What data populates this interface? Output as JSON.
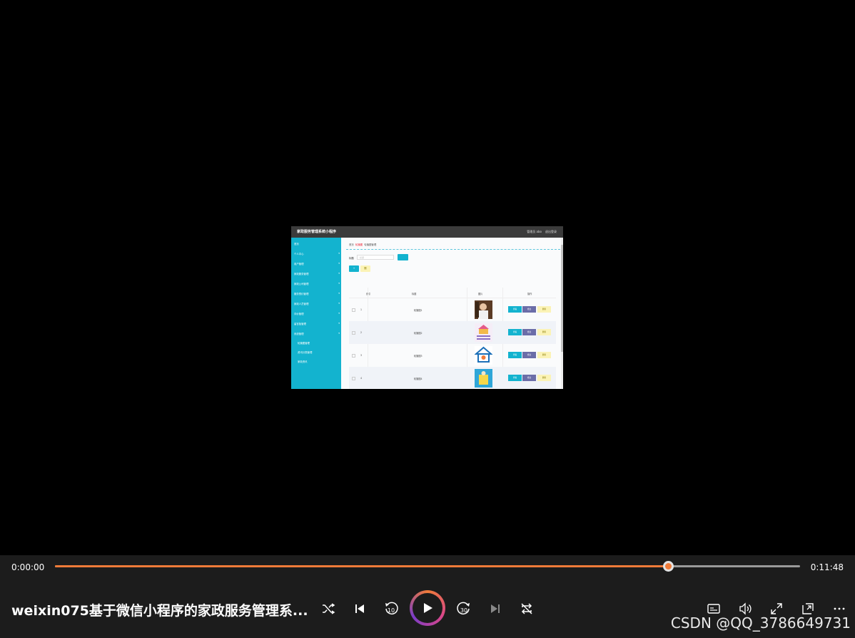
{
  "video_frame": {
    "app_title": "家政服务管理系统小程序",
    "user_label": "管理员 abo",
    "logout_label": "退出登录",
    "nav": [
      {
        "label": "首页"
      },
      {
        "label": "个人中心"
      },
      {
        "label": "用户管理"
      },
      {
        "label": "家政服务管理"
      },
      {
        "label": "家政公司管理"
      },
      {
        "label": "服务预约管理"
      },
      {
        "label": "家政人员管理"
      },
      {
        "label": "评价管理"
      },
      {
        "label": "留言板管理"
      },
      {
        "label": "系统管理"
      }
    ],
    "subnav": [
      {
        "label": "轮播图管理"
      },
      {
        "label": "资讯分类管理"
      },
      {
        "label": "家政资讯"
      }
    ],
    "breadcrumb": {
      "home": "首页",
      "current": "轮播图",
      "last": "轮播图管理"
    },
    "search": {
      "label": "标题",
      "placeholder": "标题"
    },
    "buttons": {
      "add": "+",
      "delete": "删"
    },
    "table": {
      "headers": [
        "索引",
        "标题",
        "图片",
        "操作"
      ],
      "rows": [
        {
          "index": "1",
          "title": "轮播图1"
        },
        {
          "index": "2",
          "title": "轮播图2"
        },
        {
          "index": "3",
          "title": "轮播图3"
        },
        {
          "index": "4",
          "title": "轮播图4"
        }
      ],
      "row_actions": {
        "view": "查看",
        "edit": "修改",
        "remove": "删除"
      }
    }
  },
  "player": {
    "time_current": "0:00:00",
    "time_total": "0:11:48",
    "progress": 0.823,
    "title": "weixin075基于微信小程序的家政服务管理系...",
    "watermark": "CSDN @QQ_3786649731",
    "accent_color": "#f07b39",
    "icons": [
      "shuffle-icon",
      "skip-previous-icon",
      "rewind-10-icon",
      "play-icon",
      "forward-30-icon",
      "skip-next-icon",
      "repeat-off-icon",
      "captions-icon",
      "volume-icon",
      "fullscreen-icon",
      "mini-player-icon",
      "more-icon"
    ]
  }
}
